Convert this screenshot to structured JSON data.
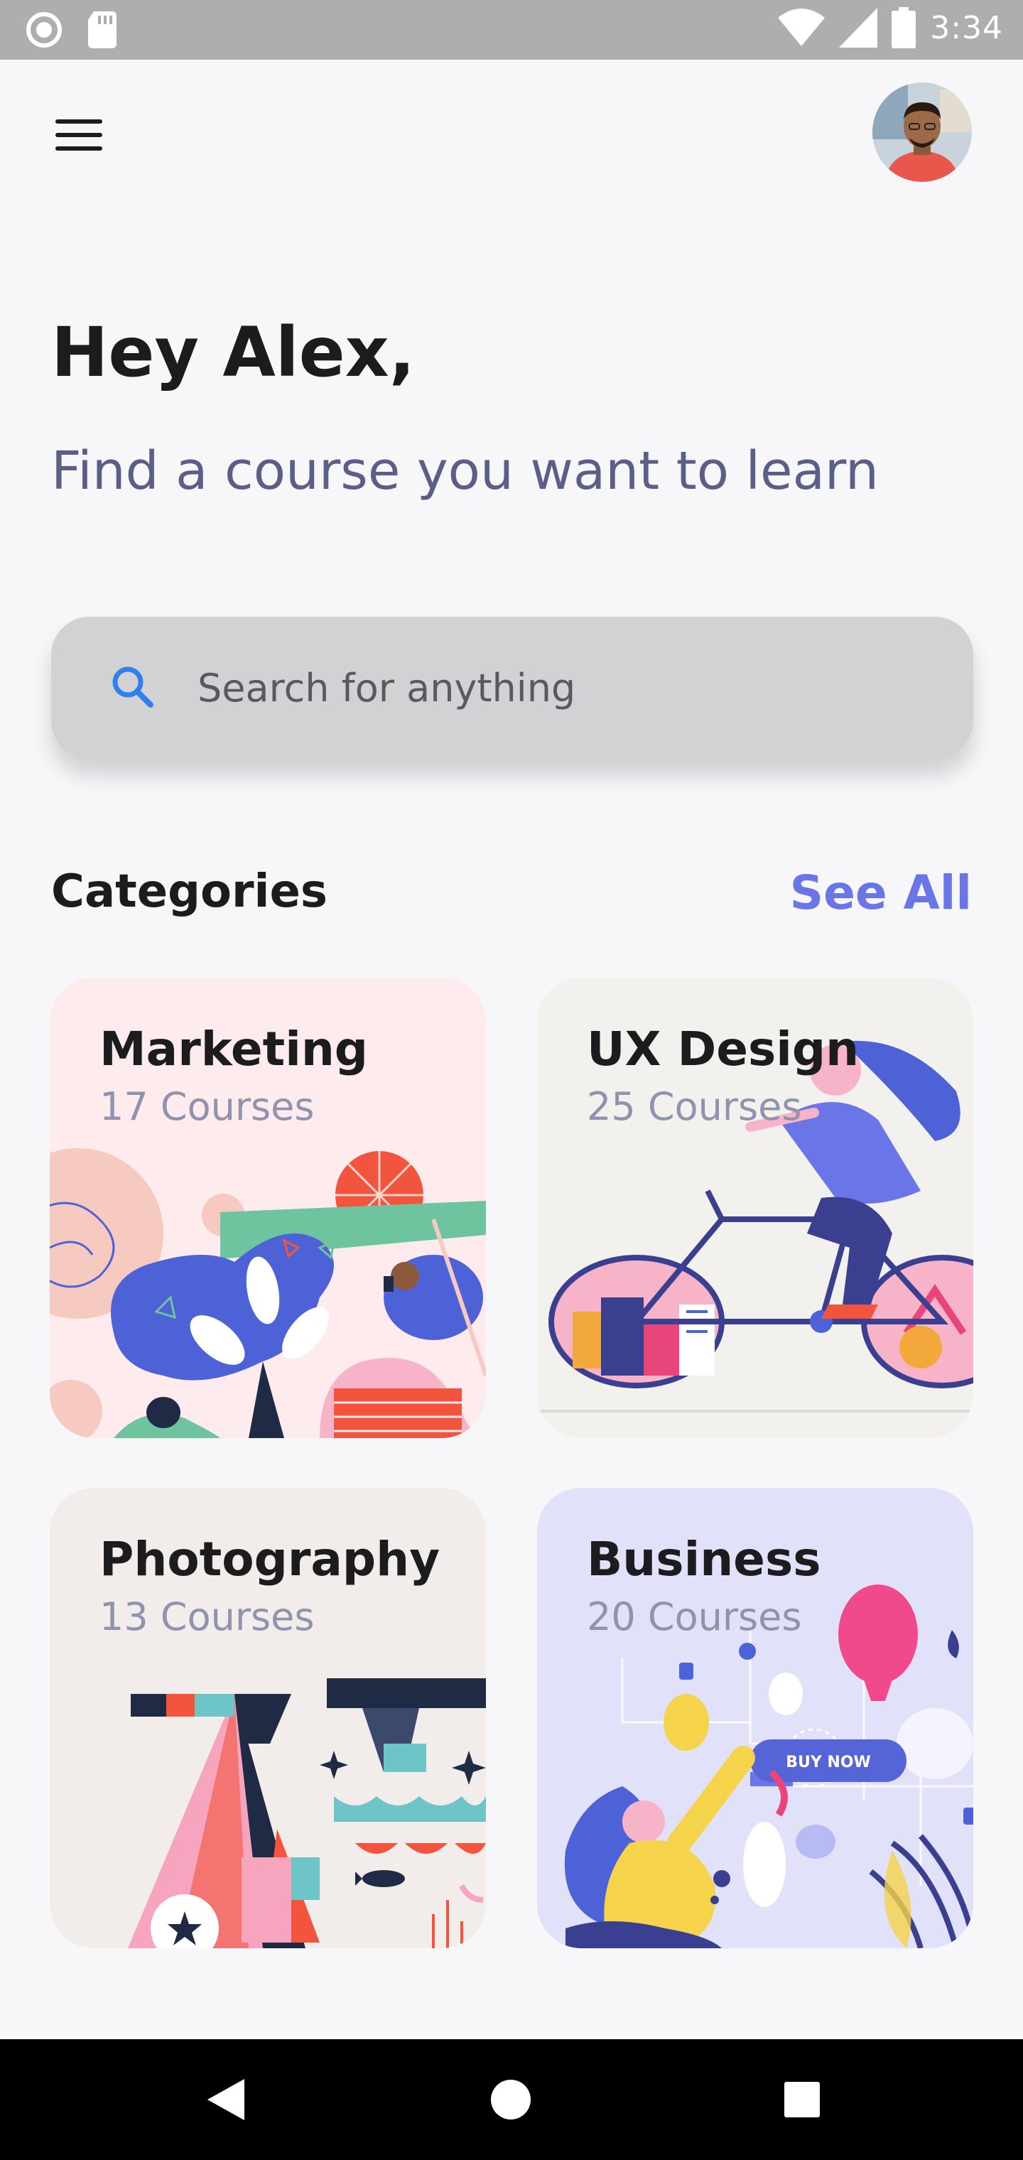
{
  "status_bar": {
    "time": "3:34",
    "icons": [
      "record-icon",
      "sd-card-icon",
      "wifi-icon",
      "signal-icon",
      "battery-icon"
    ]
  },
  "header": {
    "menu_icon": "hamburger-menu-icon",
    "avatar": "user-avatar"
  },
  "greeting": "Hey Alex,",
  "subtitle": "Find a course you want to learn",
  "search": {
    "placeholder": "Search for anything",
    "icon": "search-icon"
  },
  "categories": {
    "title": "Categories",
    "see_all": "See All",
    "items": [
      {
        "name": "Marketing",
        "count": "17 Courses"
      },
      {
        "name": "UX Design",
        "count": "25 Courses"
      },
      {
        "name": "Photography",
        "count": "13 Courses"
      },
      {
        "name": "Business",
        "count": "20 Courses",
        "badge": "BUY NOW"
      }
    ]
  },
  "nav_bar": {
    "icons": [
      "back-icon",
      "home-icon",
      "recents-icon"
    ]
  },
  "colors": {
    "accent": "#6A75E8",
    "subtitle": "#5B5F87",
    "search_icon": "#2F80ED"
  }
}
